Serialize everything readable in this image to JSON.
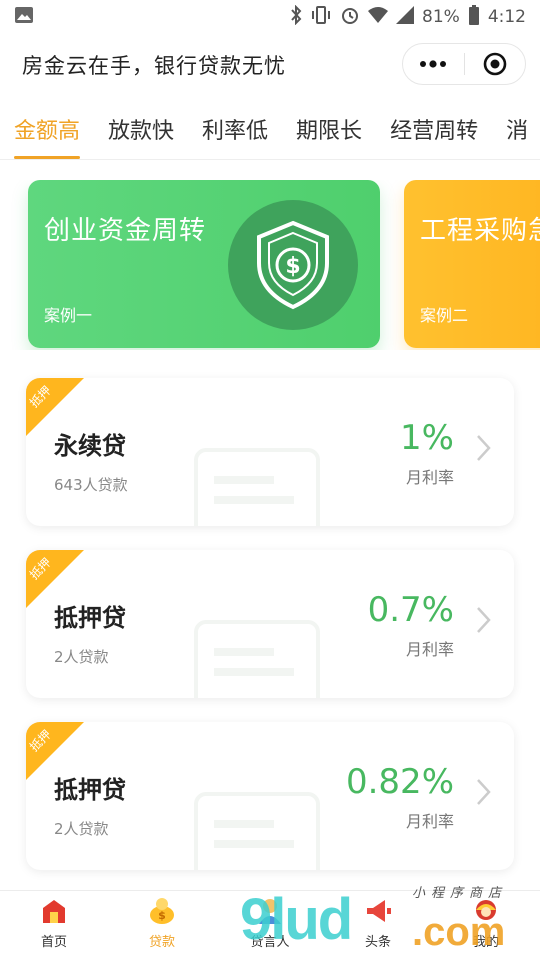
{
  "status_bar": {
    "battery_percent": "81%",
    "time": "4:12"
  },
  "header": {
    "title": "房金云在手，银行贷款无忧"
  },
  "tabs": [
    {
      "label": "金额高",
      "active": true
    },
    {
      "label": "放款快",
      "active": false
    },
    {
      "label": "利率低",
      "active": false
    },
    {
      "label": "期限长",
      "active": false
    },
    {
      "label": "经营周转",
      "active": false
    },
    {
      "label": "消",
      "active": false
    }
  ],
  "banners": [
    {
      "title": "创业资金周转",
      "case": "案例一",
      "color": "#54d274"
    },
    {
      "title": "工程采购急",
      "case": "案例二",
      "color": "#ffb622"
    }
  ],
  "loans": [
    {
      "badge": "抵押",
      "name": "永续贷",
      "count": "643人贷款",
      "rate": "1%",
      "rate_label": "月利率"
    },
    {
      "badge": "抵押",
      "name": "抵押贷",
      "count": "2人贷款",
      "rate": "0.7%",
      "rate_label": "月利率"
    },
    {
      "badge": "抵押",
      "name": "抵押贷",
      "count": "2人贷款",
      "rate": "0.82%",
      "rate_label": "月利率"
    }
  ],
  "bottom_nav": [
    {
      "label": "首页",
      "icon": "home-icon",
      "active": false
    },
    {
      "label": "贷款",
      "icon": "loan-icon",
      "active": true
    },
    {
      "label": "贷言人",
      "icon": "spokesman-icon",
      "active": false
    },
    {
      "label": "头条",
      "icon": "megaphone-icon",
      "active": false
    },
    {
      "label": "我的",
      "icon": "profile-icon",
      "active": false
    }
  ],
  "watermark": {
    "brand": "9lud",
    "suffix": ".com",
    "small": "小程序商店"
  },
  "colors": {
    "accent": "#f0a326",
    "green": "#48b860",
    "ribbon": "#ffb61e"
  }
}
